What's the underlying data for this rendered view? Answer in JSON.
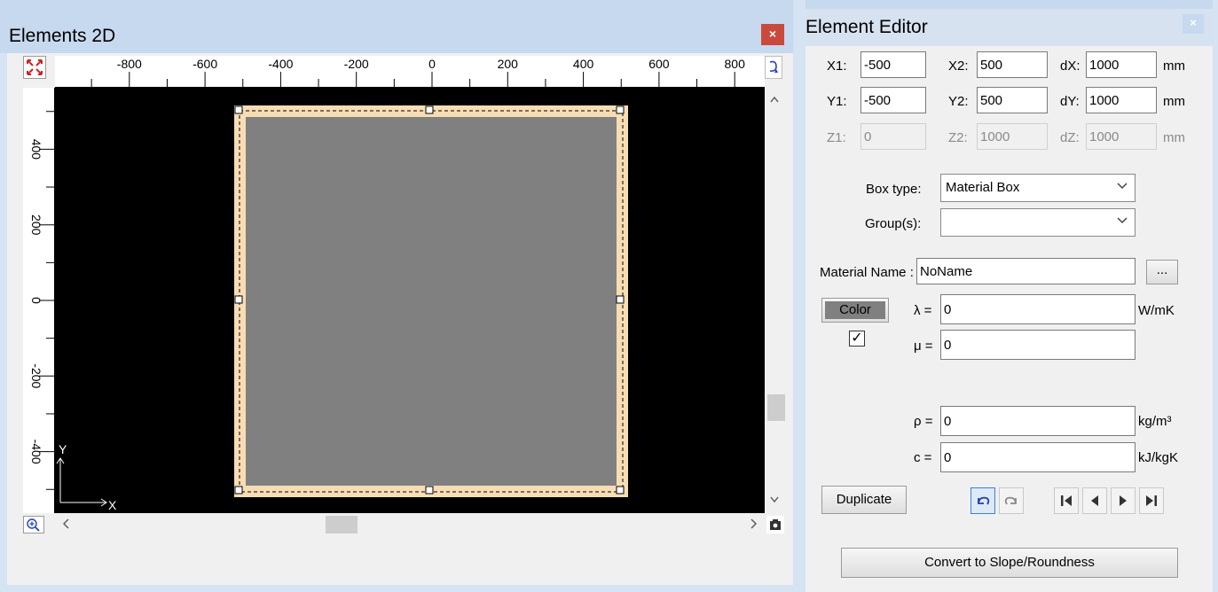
{
  "elements2d": {
    "title": "Elements 2D",
    "close_glyph": "×",
    "ruler_x_labels": [
      "-800",
      "-600",
      "-400",
      "-200",
      "0",
      "200",
      "400",
      "600",
      "800"
    ],
    "ruler_y_labels": [
      "400",
      "200",
      "0",
      "-200",
      "-400"
    ],
    "axis_y_label": "Y",
    "axis_x_label": "X",
    "icons": {
      "zoom_fit": "zoom-fit-icon",
      "rotate": "rotate-view-icon",
      "zoom_in": "zoom-in-icon",
      "camera": "camera-icon"
    },
    "colors": {
      "canvas_bg": "#000000",
      "box_border": "#f8ddb4",
      "box_fill": "#808080",
      "close_bg": "#c94a3d"
    }
  },
  "editor": {
    "title": "Element Editor",
    "close_glyph": "×",
    "x1_label": "X1:",
    "x1_value": "-500",
    "x2_label": "X2:",
    "x2_value": "500",
    "dx_label": "dX:",
    "dx_value": "1000",
    "y1_label": "Y1:",
    "y1_value": "-500",
    "y2_label": "Y2:",
    "y2_value": "500",
    "dy_label": "dY:",
    "dy_value": "1000",
    "z1_label": "Z1:",
    "z1_value": "0",
    "z2_label": "Z2:",
    "z2_value": "1000",
    "dz_label": "dZ:",
    "dz_value": "1000",
    "unit_mm": "mm",
    "box_type_label": "Box type:",
    "box_type_value": "Material Box",
    "groups_label": "Group(s):",
    "groups_value": "",
    "material_name_label": "Material Name :",
    "material_name_value": "NoName",
    "browse_label": "...",
    "color_label": "Color",
    "color_swatch": "#808080",
    "color_checked": true,
    "check_glyph": "✓",
    "lambda_label": "λ =",
    "lambda_value": "0",
    "lambda_unit": "W/mK",
    "mu_label": "μ =",
    "mu_value": "0",
    "rho_label": "ρ =",
    "rho_value": "0",
    "rho_unit": "kg/m³",
    "c_label": "c =",
    "c_value": "0",
    "c_unit": "kJ/kgK",
    "duplicate_label": "Duplicate",
    "convert_label": "Convert to Slope/Roundness",
    "nav_icons": [
      "undo-icon",
      "redo-icon",
      "first-record-icon",
      "previous-record-icon",
      "next-record-icon",
      "last-record-icon"
    ]
  }
}
